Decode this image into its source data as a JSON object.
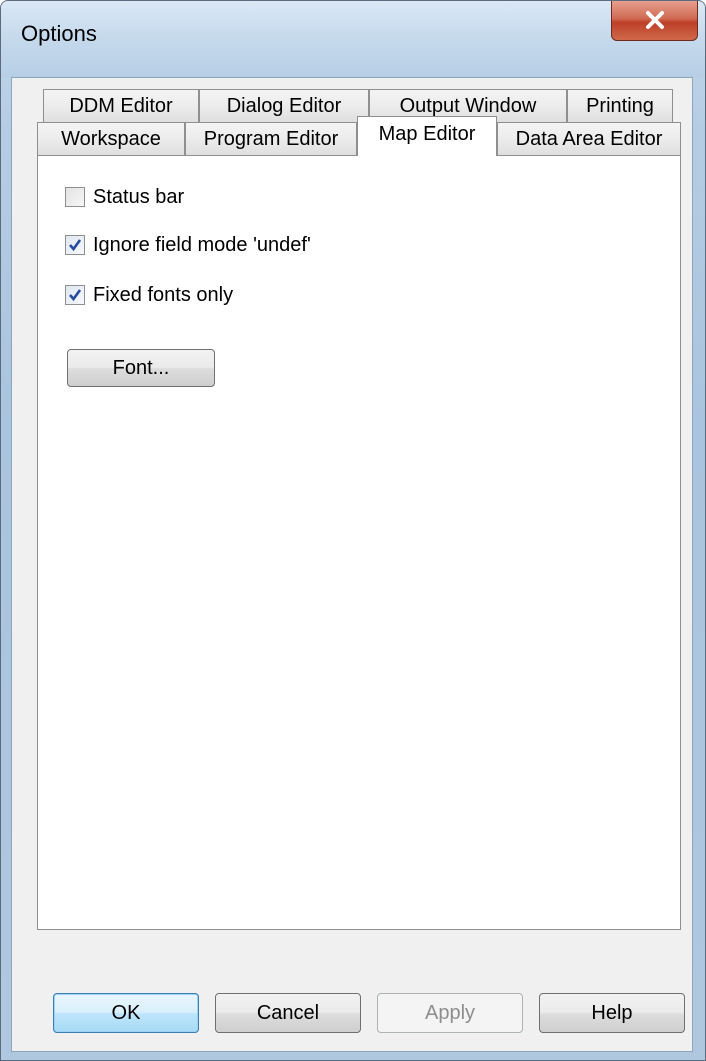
{
  "window": {
    "title": "Options"
  },
  "tabs": {
    "row1": [
      "DDM Editor",
      "Dialog Editor",
      "Output Window",
      "Printing"
    ],
    "row2": [
      "Workspace",
      "Program Editor",
      "Map Editor",
      "Data Area Editor"
    ],
    "active": "Map Editor"
  },
  "map_editor": {
    "status_bar": {
      "label": "Status bar",
      "checked": false
    },
    "ignore_undef": {
      "label": "Ignore field mode 'undef'",
      "checked": true
    },
    "fixed_fonts": {
      "label": "Fixed fonts only",
      "checked": true
    },
    "font_button": "Font..."
  },
  "buttons": {
    "ok": "OK",
    "cancel": "Cancel",
    "apply": "Apply",
    "help": "Help"
  },
  "colors": {
    "close_button": "#c4452a",
    "checkmark": "#264a9c"
  }
}
